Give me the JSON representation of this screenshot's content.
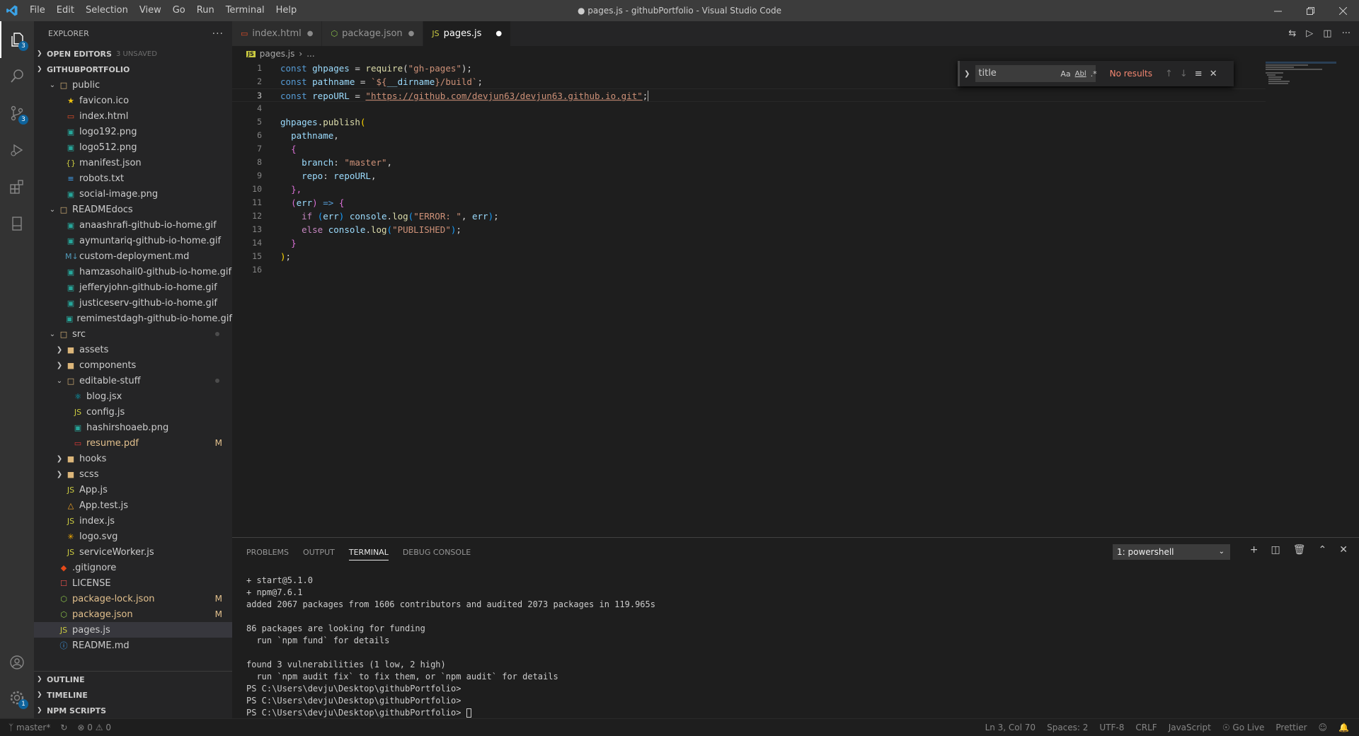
{
  "window": {
    "title": "● pages.js - githubPortfolio - Visual Studio Code"
  },
  "menu": [
    "File",
    "Edit",
    "Selection",
    "View",
    "Go",
    "Run",
    "Terminal",
    "Help"
  ],
  "activity": {
    "explorer_badge": "3",
    "scm_badge": "3",
    "settings_badge": "1"
  },
  "sidebar": {
    "title": "EXPLORER",
    "open_editors": "OPEN EDITORS",
    "unsaved": "3 UNSAVED",
    "root": "GITHUBPORTFOLIO",
    "tree": [
      {
        "label": "public",
        "depth": 1,
        "kind": "folder-open",
        "color": "#cccccc"
      },
      {
        "label": "favicon.ico",
        "depth": 2,
        "kind": "star",
        "color": "#cccccc"
      },
      {
        "label": "index.html",
        "depth": 2,
        "kind": "html",
        "color": "#cccccc"
      },
      {
        "label": "logo192.png",
        "depth": 2,
        "kind": "img",
        "color": "#cccccc"
      },
      {
        "label": "logo512.png",
        "depth": 2,
        "kind": "img",
        "color": "#cccccc"
      },
      {
        "label": "manifest.json",
        "depth": 2,
        "kind": "json",
        "color": "#cccccc"
      },
      {
        "label": "robots.txt",
        "depth": 2,
        "kind": "txt",
        "color": "#cccccc"
      },
      {
        "label": "social-image.png",
        "depth": 2,
        "kind": "img",
        "color": "#cccccc"
      },
      {
        "label": "READMEdocs",
        "depth": 1,
        "kind": "folder-open",
        "color": "#cccccc"
      },
      {
        "label": "anaashrafi-github-io-home.gif",
        "depth": 2,
        "kind": "img",
        "color": "#cccccc"
      },
      {
        "label": "aymuntariq-github-io-home.gif",
        "depth": 2,
        "kind": "img",
        "color": "#cccccc"
      },
      {
        "label": "custom-deployment.md",
        "depth": 2,
        "kind": "md",
        "color": "#cccccc"
      },
      {
        "label": "hamzasohail0-github-io-home.gif",
        "depth": 2,
        "kind": "img",
        "color": "#cccccc"
      },
      {
        "label": "jefferyjohn-github-io-home.gif",
        "depth": 2,
        "kind": "img",
        "color": "#cccccc"
      },
      {
        "label": "justiceserv-github-io-home.gif",
        "depth": 2,
        "kind": "img",
        "color": "#cccccc"
      },
      {
        "label": "remimestdagh-github-io-home.gif",
        "depth": 2,
        "kind": "img",
        "color": "#cccccc"
      },
      {
        "label": "src",
        "depth": 1,
        "kind": "folder-open",
        "color": "#cccccc",
        "dot": true
      },
      {
        "label": "assets",
        "depth": 2,
        "kind": "folder",
        "color": "#cccccc"
      },
      {
        "label": "components",
        "depth": 2,
        "kind": "folder",
        "color": "#cccccc"
      },
      {
        "label": "editable-stuff",
        "depth": 2,
        "kind": "folder-open",
        "color": "#cccccc",
        "dot": true
      },
      {
        "label": "blog.jsx",
        "depth": 3,
        "kind": "react",
        "color": "#cccccc"
      },
      {
        "label": "config.js",
        "depth": 3,
        "kind": "js",
        "color": "#cccccc"
      },
      {
        "label": "hashirshoaeb.png",
        "depth": 3,
        "kind": "img",
        "color": "#cccccc"
      },
      {
        "label": "resume.pdf",
        "depth": 3,
        "kind": "pdf",
        "color": "#e2c08d",
        "mark": "M"
      },
      {
        "label": "hooks",
        "depth": 2,
        "kind": "folder",
        "color": "#cccccc"
      },
      {
        "label": "scss",
        "depth": 2,
        "kind": "folder",
        "color": "#cccccc"
      },
      {
        "label": "App.js",
        "depth": 2,
        "kind": "js",
        "color": "#cccccc"
      },
      {
        "label": "App.test.js",
        "depth": 2,
        "kind": "test",
        "color": "#cccccc"
      },
      {
        "label": "index.js",
        "depth": 2,
        "kind": "js",
        "color": "#cccccc"
      },
      {
        "label": "logo.svg",
        "depth": 2,
        "kind": "svg",
        "color": "#cccccc"
      },
      {
        "label": "serviceWorker.js",
        "depth": 2,
        "kind": "js",
        "color": "#cccccc"
      },
      {
        "label": ".gitignore",
        "depth": 1,
        "kind": "git",
        "color": "#cccccc"
      },
      {
        "label": "LICENSE",
        "depth": 1,
        "kind": "license",
        "color": "#cccccc"
      },
      {
        "label": "package-lock.json",
        "depth": 1,
        "kind": "npm",
        "color": "#e2c08d",
        "mark": "M"
      },
      {
        "label": "package.json",
        "depth": 1,
        "kind": "npm",
        "color": "#e2c08d",
        "mark": "M"
      },
      {
        "label": "pages.js",
        "depth": 1,
        "kind": "js",
        "color": "#cccccc",
        "selected": true
      },
      {
        "label": "README.md",
        "depth": 1,
        "kind": "info",
        "color": "#cccccc"
      }
    ],
    "outline": "OUTLINE",
    "timeline": "TIMELINE",
    "npm_scripts": "NPM SCRIPTS"
  },
  "tabs": [
    {
      "label": "index.html",
      "icon": "html",
      "active": false
    },
    {
      "label": "package.json",
      "icon": "npm",
      "active": false
    },
    {
      "label": "pages.js",
      "icon": "js",
      "active": true
    }
  ],
  "breadcrumb": {
    "file": "pages.js",
    "rest": "..."
  },
  "find": {
    "value": "title",
    "result": "No results",
    "case": "Aa",
    "word": "Abl",
    "regex": ".*"
  },
  "code": [
    [
      [
        "kw",
        "const "
      ],
      [
        "vr",
        "ghpages"
      ],
      [
        "pl",
        " = "
      ],
      [
        "fn",
        "require"
      ],
      [
        "pl",
        "("
      ],
      [
        "st",
        "\"gh-pages\""
      ],
      [
        "pl",
        ");"
      ]
    ],
    [
      [
        "kw",
        "const "
      ],
      [
        "vr",
        "pathname"
      ],
      [
        "pl",
        " = "
      ],
      [
        "st",
        "`${"
      ],
      [
        "vr",
        "__dirname"
      ],
      [
        "st",
        "}/build`"
      ],
      [
        "pl",
        ";"
      ]
    ],
    [
      [
        "kw",
        "const "
      ],
      [
        "vr",
        "repoURL"
      ],
      [
        "pl",
        " = "
      ],
      [
        "st",
        "\"https://github.com/devjun63/devjun63.github.io.git\""
      ],
      [
        "pl",
        ";"
      ]
    ],
    [],
    [
      [
        "vr",
        "ghpages"
      ],
      [
        "pl",
        "."
      ],
      [
        "fn",
        "publish"
      ],
      [
        "br",
        "("
      ]
    ],
    [
      [
        "pl",
        "  "
      ],
      [
        "vr",
        "pathname"
      ],
      [
        "pl",
        ","
      ]
    ],
    [
      [
        "pl",
        "  "
      ],
      [
        "br2",
        "{"
      ]
    ],
    [
      [
        "pl",
        "    "
      ],
      [
        "vr",
        "branch"
      ],
      [
        "pl",
        ": "
      ],
      [
        "st",
        "\"master\""
      ],
      [
        "pl",
        ","
      ]
    ],
    [
      [
        "pl",
        "    "
      ],
      [
        "vr",
        "repo"
      ],
      [
        "pl",
        ": "
      ],
      [
        "vr",
        "repoURL"
      ],
      [
        "pl",
        ","
      ]
    ],
    [
      [
        "pl",
        "  "
      ],
      [
        "br2",
        "},"
      ]
    ],
    [
      [
        "pl",
        "  "
      ],
      [
        "br2",
        "("
      ],
      [
        "vr",
        "err"
      ],
      [
        "br2",
        ")"
      ],
      [
        "kw",
        " => "
      ],
      [
        "br2",
        "{"
      ]
    ],
    [
      [
        "pl",
        "    "
      ],
      [
        "ctl",
        "if "
      ],
      [
        "br3",
        "("
      ],
      [
        "vr",
        "err"
      ],
      [
        "br3",
        ")"
      ],
      [
        "pl",
        " "
      ],
      [
        "vr",
        "console"
      ],
      [
        "pl",
        "."
      ],
      [
        "fn",
        "log"
      ],
      [
        "br3",
        "("
      ],
      [
        "st",
        "\"ERROR: \""
      ],
      [
        "pl",
        ", "
      ],
      [
        "vr",
        "err"
      ],
      [
        "br3",
        ")"
      ],
      [
        "pl",
        ";"
      ]
    ],
    [
      [
        "pl",
        "    "
      ],
      [
        "ctl",
        "else "
      ],
      [
        "vr",
        "console"
      ],
      [
        "pl",
        "."
      ],
      [
        "fn",
        "log"
      ],
      [
        "br3",
        "("
      ],
      [
        "st",
        "\"PUBLISHED\""
      ],
      [
        "br3",
        ")"
      ],
      [
        "pl",
        ";"
      ]
    ],
    [
      [
        "pl",
        "  "
      ],
      [
        "br2",
        "}"
      ]
    ],
    [
      [
        "br",
        ")"
      ],
      [
        "pl",
        ";"
      ]
    ],
    []
  ],
  "panel": {
    "tabs": [
      "PROBLEMS",
      "OUTPUT",
      "TERMINAL",
      "DEBUG CONSOLE"
    ],
    "shell": "1: powershell",
    "terminal": "+ start@5.1.0\n+ npm@7.6.1\nadded 2067 packages from 1606 contributors and audited 2073 packages in 119.965s\n\n86 packages are looking for funding\n  run `npm fund` for details\n\nfound 3 vulnerabilities (1 low, 2 high)\n  run `npm audit fix` to fix them, or `npm audit` for details\nPS C:\\Users\\devju\\Desktop\\githubPortfolio>\nPS C:\\Users\\devju\\Desktop\\githubPortfolio>\nPS C:\\Users\\devju\\Desktop\\githubPortfolio> "
  },
  "status": {
    "branch": "master*",
    "errors": "0",
    "warnings": "0",
    "position": "Ln 3, Col 70",
    "spaces": "Spaces: 2",
    "encoding": "UTF-8",
    "eol": "CRLF",
    "language": "JavaScript",
    "golive": "Go Live",
    "prettier": "Prettier"
  }
}
